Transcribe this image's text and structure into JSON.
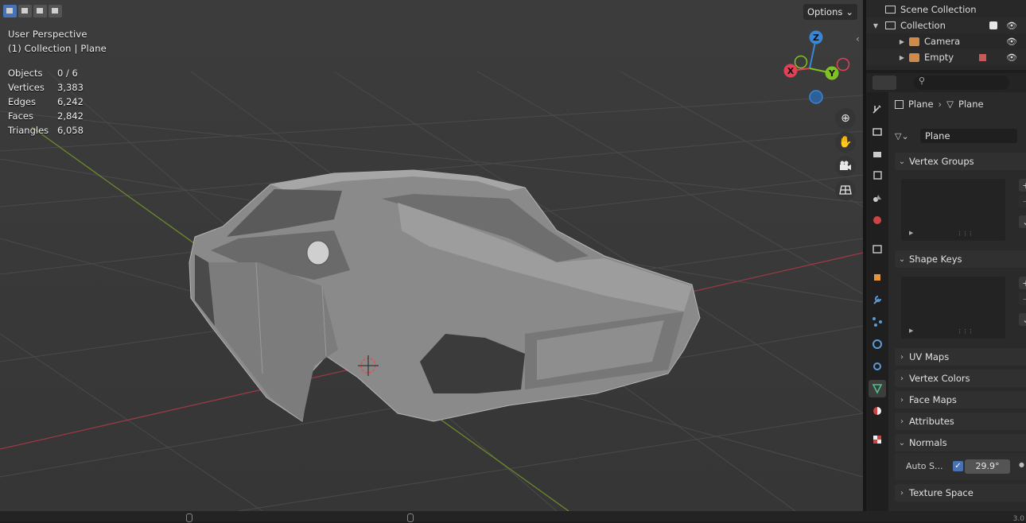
{
  "viewport": {
    "title": "User Perspective",
    "subtitle": "(1) Collection | Plane",
    "stats": [
      {
        "label": "Objects",
        "value": "0 / 6"
      },
      {
        "label": "Vertices",
        "value": "3,383"
      },
      {
        "label": "Edges",
        "value": "6,242"
      },
      {
        "label": "Faces",
        "value": "2,842"
      },
      {
        "label": "Triangles",
        "value": "6,058"
      }
    ],
    "options_label": "Options",
    "gizmo": {
      "x": "X",
      "y": "Y",
      "z": "Z"
    }
  },
  "outliner": {
    "rows": [
      {
        "label": "Scene Collection"
      },
      {
        "label": "Collection"
      },
      {
        "label": "Camera"
      },
      {
        "label": "Empty"
      }
    ]
  },
  "properties": {
    "breadcrumb": {
      "object": "Plane",
      "data": "Plane"
    },
    "mesh_name": "Plane",
    "panels": {
      "vertex_groups": "Vertex Groups",
      "shape_keys": "Shape Keys",
      "uv_maps": "UV Maps",
      "vertex_colors": "Vertex Colors",
      "face_maps": "Face Maps",
      "attributes": "Attributes",
      "normals": "Normals",
      "texture_space": "Texture Space"
    },
    "auto_smooth_label": "Auto S...",
    "auto_smooth_value": "29.9°",
    "auto_smooth_checked": true
  },
  "status": {
    "version": "3.0"
  },
  "colors": {
    "accent": "#4772b3",
    "x_axis": "#e04156",
    "y_axis": "#7fc224",
    "z_axis": "#3a86d6"
  }
}
